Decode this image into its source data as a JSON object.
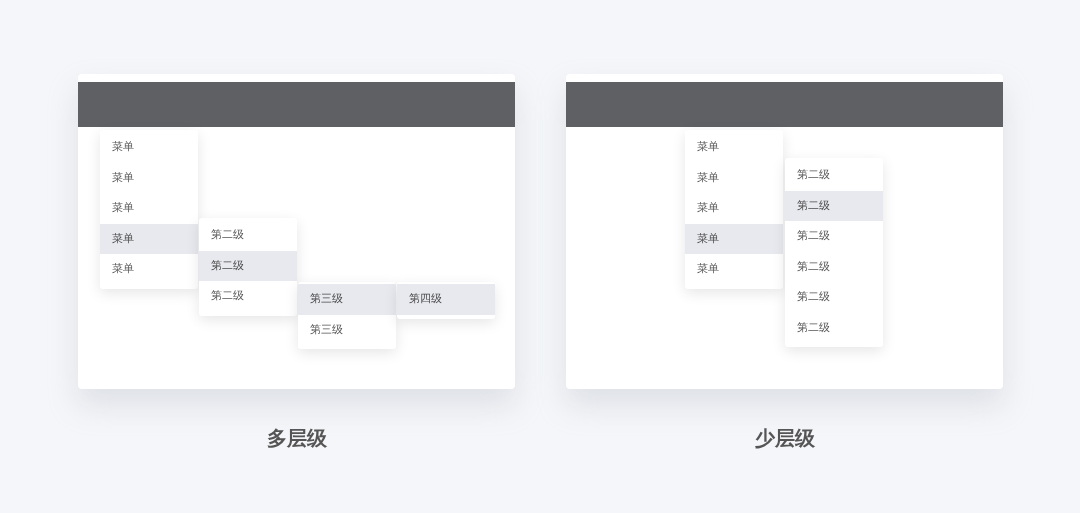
{
  "panels": [
    {
      "caption": "多层级",
      "menus": [
        {
          "items": [
            {
              "label": "菜单",
              "selected": false
            },
            {
              "label": "菜单",
              "selected": false
            },
            {
              "label": "菜单",
              "selected": false
            },
            {
              "label": "菜单",
              "selected": true
            },
            {
              "label": "菜单",
              "selected": false
            }
          ]
        },
        {
          "items": [
            {
              "label": "第二级",
              "selected": false
            },
            {
              "label": "第二级",
              "selected": true
            },
            {
              "label": "第二级",
              "selected": false
            }
          ]
        },
        {
          "items": [
            {
              "label": "第三级",
              "selected": true
            },
            {
              "label": "第三级",
              "selected": false
            }
          ]
        },
        {
          "items": [
            {
              "label": "第四级",
              "selected": true
            }
          ]
        }
      ]
    },
    {
      "caption": "少层级",
      "menus": [
        {
          "items": [
            {
              "label": "菜单",
              "selected": false
            },
            {
              "label": "菜单",
              "selected": false
            },
            {
              "label": "菜单",
              "selected": false
            },
            {
              "label": "菜单",
              "selected": true
            },
            {
              "label": "菜单",
              "selected": false
            }
          ]
        },
        {
          "items": [
            {
              "label": "第二级",
              "selected": false
            },
            {
              "label": "第二级",
              "selected": true
            },
            {
              "label": "第二级",
              "selected": false
            },
            {
              "label": "第二级",
              "selected": false
            },
            {
              "label": "第二级",
              "selected": false
            },
            {
              "label": "第二级",
              "selected": false
            }
          ]
        }
      ]
    }
  ]
}
